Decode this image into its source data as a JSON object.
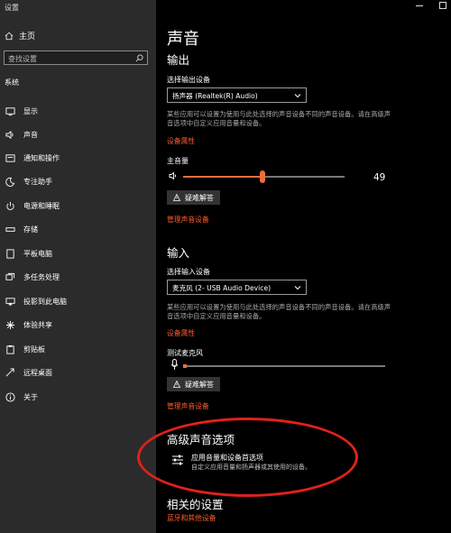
{
  "window": {
    "title": "设置"
  },
  "sidebar": {
    "home_label": "主页",
    "search_placeholder": "查找设置",
    "section_label": "系统",
    "items": [
      {
        "label": "显示",
        "icon": "monitor-icon"
      },
      {
        "label": "声音",
        "icon": "speaker-icon"
      },
      {
        "label": "通知和操作",
        "icon": "notification-icon"
      },
      {
        "label": "专注助手",
        "icon": "moon-icon"
      },
      {
        "label": "电源和睡眠",
        "icon": "power-icon"
      },
      {
        "label": "存储",
        "icon": "drive-icon"
      },
      {
        "label": "平板电脑",
        "icon": "tablet-icon"
      },
      {
        "label": "多任务处理",
        "icon": "multitask-icon"
      },
      {
        "label": "投影到此电脑",
        "icon": "project-icon"
      },
      {
        "label": "体验共享",
        "icon": "share-icon"
      },
      {
        "label": "剪贴板",
        "icon": "clipboard-icon"
      },
      {
        "label": "远程桌面",
        "icon": "remote-icon"
      },
      {
        "label": "关于",
        "icon": "info-icon"
      }
    ]
  },
  "main": {
    "title": "声音",
    "output": {
      "heading": "输出",
      "device_label": "选择输出设备",
      "device_value": "扬声器 (Realtek(R) Audio)",
      "description": "某些应用可以设置为使用与此处选择的声音设备不同的声音设备。请在高级声音选项中自定义应用音量和设备。",
      "device_props_link": "设备属性",
      "master_volume_label": "主音量",
      "volume_value": "49",
      "volume_fraction": 0.49,
      "troubleshoot_label": "疑难解答",
      "manage_link": "管理声音设备"
    },
    "input": {
      "heading": "输入",
      "device_label": "选择输入设备",
      "device_value": "麦克风 (2- USB Audio Device)",
      "description": "某些应用可以设置为使用与此处选择的声音设备不同的声音设备。请在高级声音选项中自定义应用音量和设备。",
      "device_props_link": "设备属性",
      "test_mic_label": "测试麦克风",
      "troubleshoot_label": "疑难解答",
      "manage_link": "管理声音设备"
    },
    "advanced": {
      "heading": "高级声音选项",
      "item_title": "应用音量和设备首选项",
      "item_desc": "自定义应用音量和扬声器或其使用的设备。"
    },
    "related": {
      "heading": "相关的设置",
      "link": "蓝牙和其他设备"
    }
  },
  "colors": {
    "accent": "#ff5b2c",
    "sidebar_bg": "#2b2b2b",
    "annotation": "#e0211b"
  }
}
